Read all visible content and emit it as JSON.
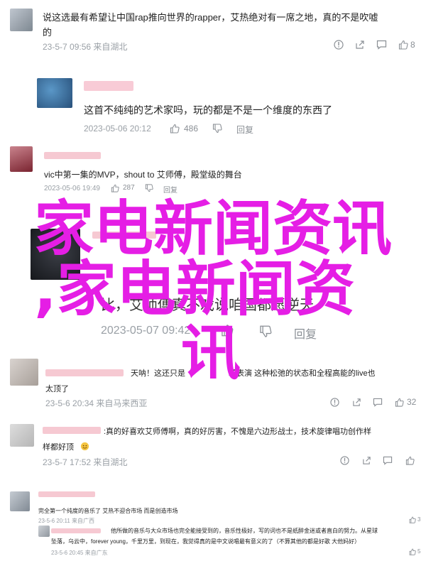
{
  "overlay_title": {
    "line1": "家电新闻资讯",
    "line2": ",家电新闻资",
    "line3": "讯"
  },
  "comments": [
    {
      "text": "说这选最有希望让中国rap推向世界的rapper，艾热绝对有一席之地，真的不是吹嘘",
      "text2": "的",
      "time": "23-5-7 09:56 来自湖北",
      "likes": "8"
    },
    {
      "text": "这首不纯纯的艺术家吗，玩的都是不是一个维度的东西了",
      "time": "2023-05-06 20:12",
      "likes": "486",
      "reply": "回复"
    },
    {
      "text": "vic中第一集的MVP，shout to 艾师傅，殿堂级的舞台",
      "time": "2023-05-06 19:49",
      "likes": "287",
      "reply": "回复"
    },
    {
      "text": "比，艾师傅真不戏说咱国都愿逆天",
      "time": "2023-05-07 09:42",
      "likes": "16",
      "reply": "回复"
    },
    {
      "text": "天呐！这还只是",
      "text_b": "场表演 这种松弛的状态和全程高能的live也",
      "text2": "太顶了",
      "time": "23-5-6 20:34 来自马来西亚",
      "likes": "32"
    },
    {
      "text": ":真的好喜欢艾师傅啊，真的好厉害，不愧是六边形战士，技术旋律唱功创作样",
      "text2": "样都好顶",
      "time": "23-5-7 17:52 来自湖北",
      "likes": ""
    },
    {
      "text": "完全第一个纯度的音乐了 艾热不迎合市场 而是创造市场",
      "time": "23-5-6 20:11 来自广西",
      "likes": "3"
    },
    {
      "text": "他所做的音乐与大众市场也完全能接受到的，音乐性极好，写的词也不是纸醉金迷或者直白的努力。从星球",
      "text2": "坠落，乌云中，forever young，千里万里，到现在，我觉得真的是中文说唱最有意义的了（不算其他的都是好歌 大他妈好）",
      "time": "23-5-6 20:45 来自广东",
      "likes": "5"
    }
  ],
  "icons": [
    "info-icon",
    "share-icon",
    "comment-icon",
    "thumbs-up-icon"
  ]
}
